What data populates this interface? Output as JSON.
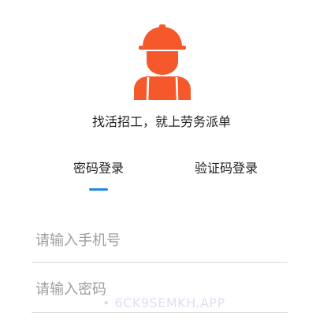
{
  "app": {
    "logo_icon": "worker-icon",
    "slogan": "找活招工，就上劳务派单"
  },
  "tabs": [
    {
      "label": "密码登录",
      "active": true
    },
    {
      "label": "验证码登录",
      "active": false
    }
  ],
  "form": {
    "phone": {
      "value": "",
      "placeholder": "请输入手机号"
    },
    "password": {
      "value": "",
      "placeholder": "请输入密码"
    }
  },
  "watermark": "• 6CK9SEMKH.APP",
  "colors": {
    "brand": "#F5582B",
    "accent": "#1E88E5",
    "text": "#222222",
    "placeholder": "#9E9E9E",
    "divider": "#DADADA",
    "watermark": "#E4DCF0"
  }
}
